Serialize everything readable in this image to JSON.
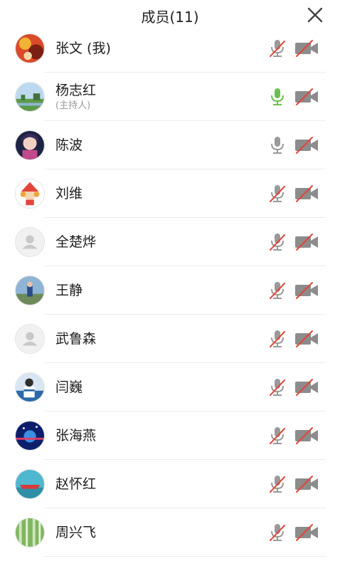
{
  "header": {
    "title": "成员(11)",
    "close_icon": "close-icon"
  },
  "colors": {
    "mic_on": "#6dc04f",
    "mic_default": "#9a9a9a",
    "muted_slash": "#e0463a",
    "icon_gray": "#8c8c8c",
    "divider": "#ececec"
  },
  "members": [
    {
      "name": "张文 (我)",
      "role": "",
      "avatar": "photo-avatar-red",
      "mic": "muted",
      "camera": "off"
    },
    {
      "name": "杨志红",
      "role": "(主持人)",
      "avatar": "photo-avatar-landscape",
      "mic": "on",
      "camera": "off"
    },
    {
      "name": "陈波",
      "role": "",
      "avatar": "photo-avatar-anime",
      "mic": "default",
      "camera": "off"
    },
    {
      "name": "刘维",
      "role": "",
      "avatar": "photo-avatar-cartoon",
      "mic": "muted",
      "camera": "off"
    },
    {
      "name": "全楚烨",
      "role": "",
      "avatar": "default-avatar",
      "mic": "muted",
      "camera": "off"
    },
    {
      "name": "王静",
      "role": "",
      "avatar": "photo-avatar-outdoor",
      "mic": "muted",
      "camera": "off"
    },
    {
      "name": "武鲁森",
      "role": "",
      "avatar": "default-avatar",
      "mic": "muted",
      "camera": "off"
    },
    {
      "name": "闫巍",
      "role": "",
      "avatar": "photo-avatar-person",
      "mic": "muted",
      "camera": "off"
    },
    {
      "name": "张海燕",
      "role": "",
      "avatar": "photo-avatar-night",
      "mic": "muted",
      "camera": "off"
    },
    {
      "name": "赵怀红",
      "role": "",
      "avatar": "photo-avatar-boat",
      "mic": "muted",
      "camera": "off"
    },
    {
      "name": "周兴飞",
      "role": "",
      "avatar": "photo-avatar-forest",
      "mic": "muted",
      "camera": "off"
    }
  ]
}
